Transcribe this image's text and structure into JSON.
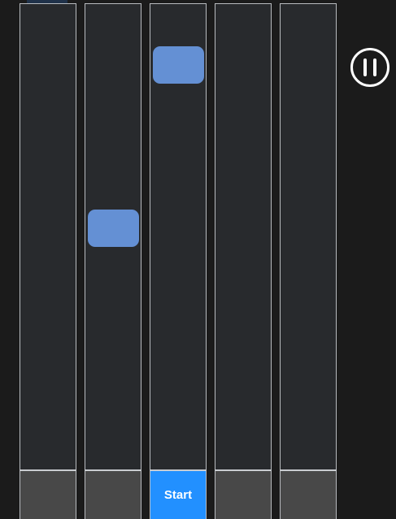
{
  "game": {
    "lane_count": 5,
    "start_label": "Start",
    "active_key_index": 2,
    "colors": {
      "background": "#1b1b1b",
      "lane": "#282a2d",
      "lane_border": "#b9bcc0",
      "key": "#484848",
      "key_active": "#2290ff",
      "note": "#6490d4",
      "pause_icon": "#ffffff"
    },
    "icons": {
      "pause": "pause-circle-icon"
    }
  }
}
